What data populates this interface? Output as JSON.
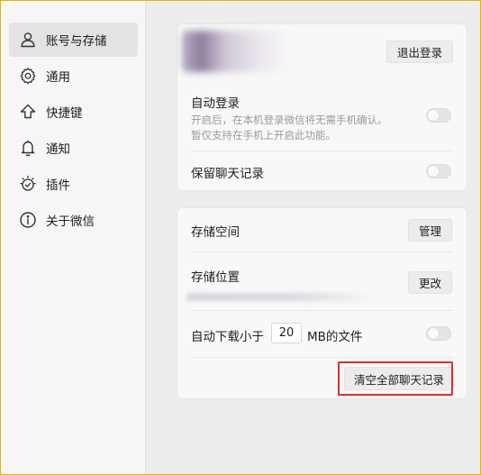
{
  "sidebar": {
    "items": [
      {
        "label": "账号与存储",
        "icon": "user-icon",
        "active": true
      },
      {
        "label": "通用",
        "icon": "gear-icon",
        "active": false
      },
      {
        "label": "快捷键",
        "icon": "shortcut-arrow-icon",
        "active": false
      },
      {
        "label": "通知",
        "icon": "bell-icon",
        "active": false
      },
      {
        "label": "插件",
        "icon": "plugin-icon",
        "active": false
      },
      {
        "label": "关于微信",
        "icon": "info-icon",
        "active": false
      }
    ]
  },
  "account": {
    "logout_label": "退出登录",
    "auto_login_title": "自动登录",
    "auto_login_desc_line1": "开启后，在本机登录微信将无需手机确认。",
    "auto_login_desc_line2": "暂仅支持在手机上开启此功能。",
    "keep_chat_title": "保留聊天记录",
    "auto_login_enabled": false,
    "keep_chat_enabled": false
  },
  "storage": {
    "space_title": "存储空间",
    "manage_label": "管理",
    "location_title": "存储位置",
    "change_label": "更改",
    "auto_download_prefix": "自动下载小于",
    "auto_download_value": "20",
    "auto_download_suffix": "MB的文件",
    "auto_download_enabled": false,
    "clear_all_label": "清空全部聊天记录"
  },
  "colors": {
    "highlight": "#e02b2b",
    "window_border": "#e8b400"
  }
}
